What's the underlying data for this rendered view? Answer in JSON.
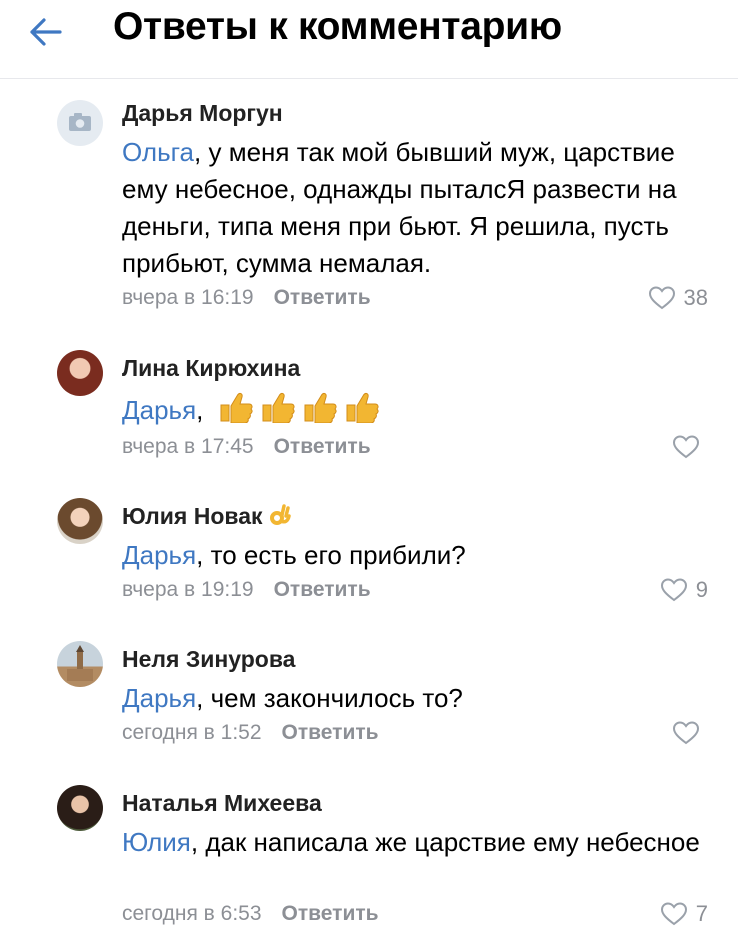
{
  "header": {
    "title": "Ответы к комментарию",
    "back_icon": "arrow-left-icon"
  },
  "colors": {
    "accent": "#3f78c2",
    "muted": "#8c8f95"
  },
  "comments": [
    {
      "author": "Дарья Моргун",
      "mention": "Ольга",
      "text": ", у меня так мой бывший муж, царствие ему небесное, однажды пыталсЯ развести на деньги, типа меня при бьют. Я решила, пусть прибьют, сумма немалая.",
      "time": "вчера в 16:19",
      "reply": "Ответить",
      "likes": "38"
    },
    {
      "author": "Лина Кирюхина",
      "mention": "Дарья",
      "text": ",",
      "emoji": "thumbs-up ×4",
      "time": "вчера в 17:45",
      "reply": "Ответить",
      "likes": ""
    },
    {
      "author": "Юлия Новак",
      "author_emoji": "ok-hand",
      "mention": "Дарья",
      "text": ", то есть его прибили?",
      "time": "вчера в 19:19",
      "reply": "Ответить",
      "likes": "9"
    },
    {
      "author": "Неля Зинурова",
      "mention": "Дарья",
      "text": ", чем закончилось то?",
      "time": "сегодня в 1:52",
      "reply": "Ответить",
      "likes": ""
    },
    {
      "author": "Наталья Михеева",
      "mention": "Юлия",
      "text": ", дак написала же царствие ему небесное",
      "time": "сегодня в 6:53",
      "reply": "Ответить",
      "likes": "7"
    }
  ]
}
